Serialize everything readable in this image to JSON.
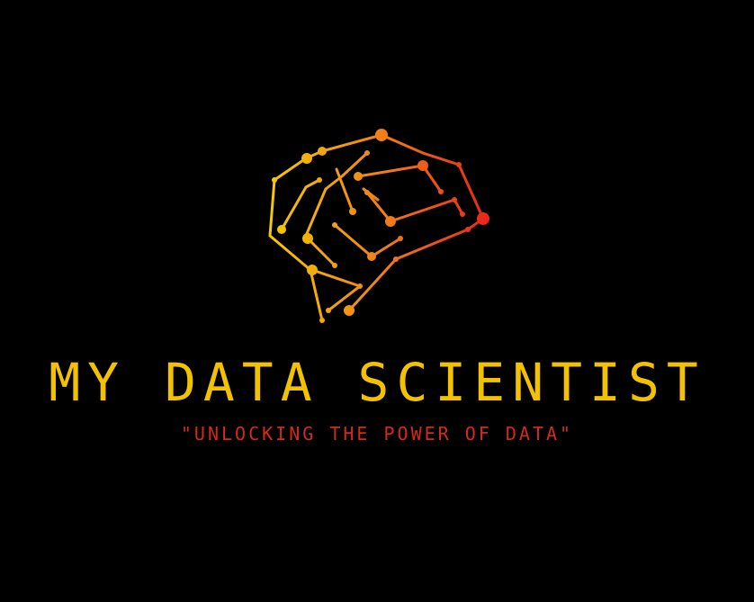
{
  "brand": {
    "title": "MY DATA SCIENTIST",
    "tagline": "\"UNLOCKING THE POWER OF DATA\""
  },
  "colors": {
    "background": "#000000",
    "title": "#f2c200",
    "tagline": "#d42a1a",
    "gradient_yellow": "#f4d000",
    "gradient_orange": "#f07a1a",
    "gradient_red": "#e8201a"
  },
  "icons": {
    "logo_mark": "brain-network-icon"
  }
}
